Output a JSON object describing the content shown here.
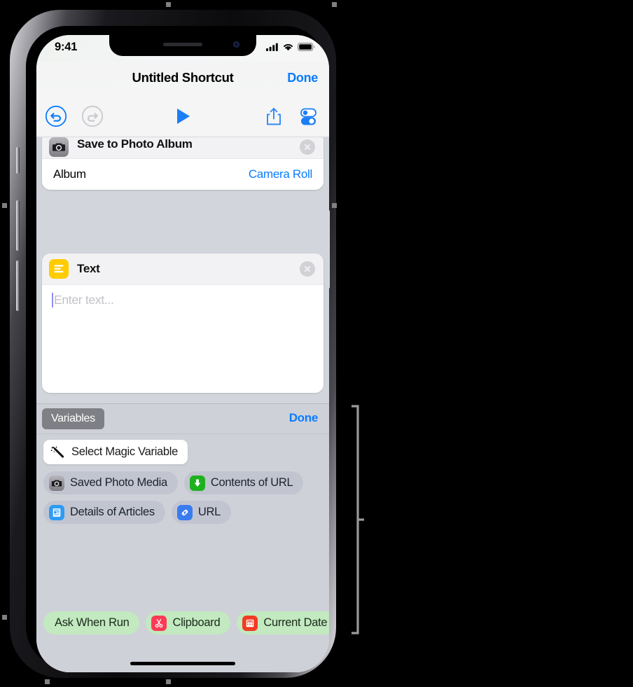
{
  "status_bar": {
    "time": "9:41",
    "icons": [
      "cellular-signal-icon",
      "wifi-icon",
      "battery-icon"
    ]
  },
  "nav_bar": {
    "title": "Untitled Shortcut",
    "done_label": "Done"
  },
  "toolbar": {
    "undo": "undo-icon",
    "redo": "redo-icon",
    "play": "play-icon",
    "share": "share-icon",
    "toggles": "settings-toggles-icon"
  },
  "actions": [
    {
      "title": "Save to Photo Album",
      "icon": "camera-icon",
      "icon_color": "#8a8a8f",
      "close_label": "×",
      "rows": [
        {
          "label": "Album",
          "value": "Camera Roll"
        }
      ]
    },
    {
      "title": "Text",
      "icon": "text-lines-icon",
      "icon_color": "#ffcc00",
      "close_label": "×",
      "placeholder": "Enter text..."
    }
  ],
  "variables_panel": {
    "tab_label": "Variables",
    "done_label": "Done",
    "magic_button": {
      "label": "Select Magic Variable",
      "icon": "magic-wand-icon"
    },
    "chip_rows": [
      [
        {
          "label": "Saved Photo Media",
          "icon": "camera-icon",
          "icon_color": "#8a8a8f"
        },
        {
          "label": "Contents of URL",
          "icon": "download-arrow-icon",
          "icon_color": "#1db21d"
        }
      ],
      [
        {
          "label": "Details of Articles",
          "icon": "article-icon",
          "icon_color": "#2e9bf5"
        },
        {
          "label": "URL",
          "icon": "link-icon",
          "icon_color": "#3a7bf0"
        }
      ]
    ],
    "bottom_chips": [
      {
        "label": "Ask When Run",
        "icon": null,
        "icon_color": null
      },
      {
        "label": "Clipboard",
        "icon": "scissors-icon",
        "icon_color": "#fc3b56"
      },
      {
        "label": "Current Date",
        "icon": "calendar-icon",
        "icon_color": "#f23b23"
      }
    ]
  },
  "colors": {
    "accent_blue": "#0a7cff",
    "panel_bg": "#cfd1d9",
    "chip_bg": "#c2c5d0",
    "chip_green": "#c2e9bf",
    "tab_gray": "#7f8085"
  }
}
